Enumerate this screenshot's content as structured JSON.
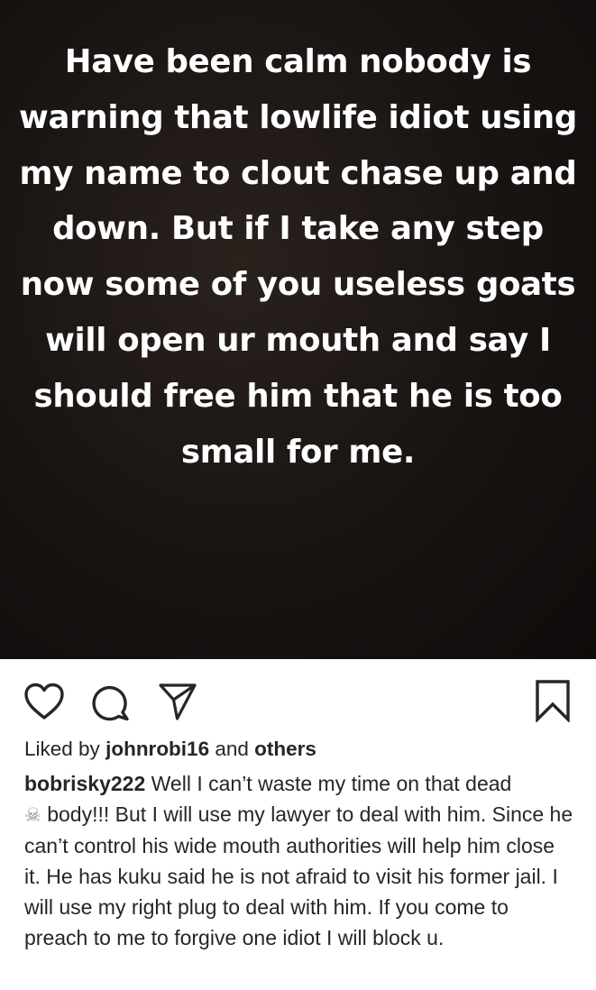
{
  "post": {
    "story_text": "Have been calm nobody is warning that lowlife idiot using my name to clout chase up and down. But if I take any step now some of you useless goats will open ur mouth and say I should free him that he is too small for me."
  },
  "actions": {
    "like_icon": "heart-icon",
    "comment_icon": "comment-icon",
    "share_icon": "send-icon",
    "save_icon": "bookmark-icon"
  },
  "likes": {
    "prefix": "Liked by",
    "user": "johnrobi16",
    "connector": "and",
    "others": "others"
  },
  "caption": {
    "username": "bobrisky222",
    "text_part1": "Well I can’t waste my time on that dead",
    "emoji": "☠",
    "text_part2": "body!!! But I will use my lawyer to deal with him. Since he can’t control his wide mouth authorities will help him close it. He has kuku said he is not afraid to visit his former jail. I will use my right plug to deal with him. If you come to preach to me to forgive one idiot I will block u."
  }
}
